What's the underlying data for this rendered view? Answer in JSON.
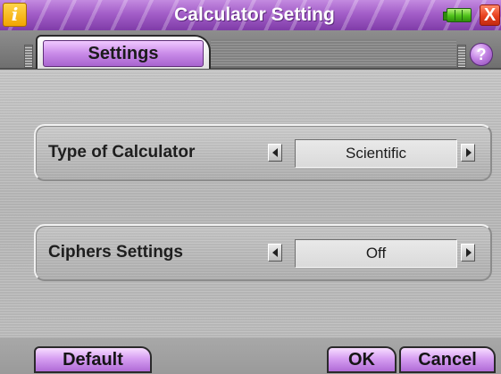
{
  "window": {
    "title": "Calculator Setting",
    "app_icon_glyph": "i",
    "close_glyph": "X",
    "accent_color": "#a35ec8",
    "icons": [
      "info-app-icon",
      "battery-icon",
      "close-icon",
      "help-icon"
    ]
  },
  "tabs": {
    "active_label": "Settings",
    "help_glyph": "?"
  },
  "settings": [
    {
      "label": "Type of Calculator",
      "value": "Scientific"
    },
    {
      "label": "Ciphers Settings",
      "value": "Off"
    }
  ],
  "footer": {
    "default_label": "Default",
    "ok_label": "OK",
    "cancel_label": "Cancel"
  }
}
